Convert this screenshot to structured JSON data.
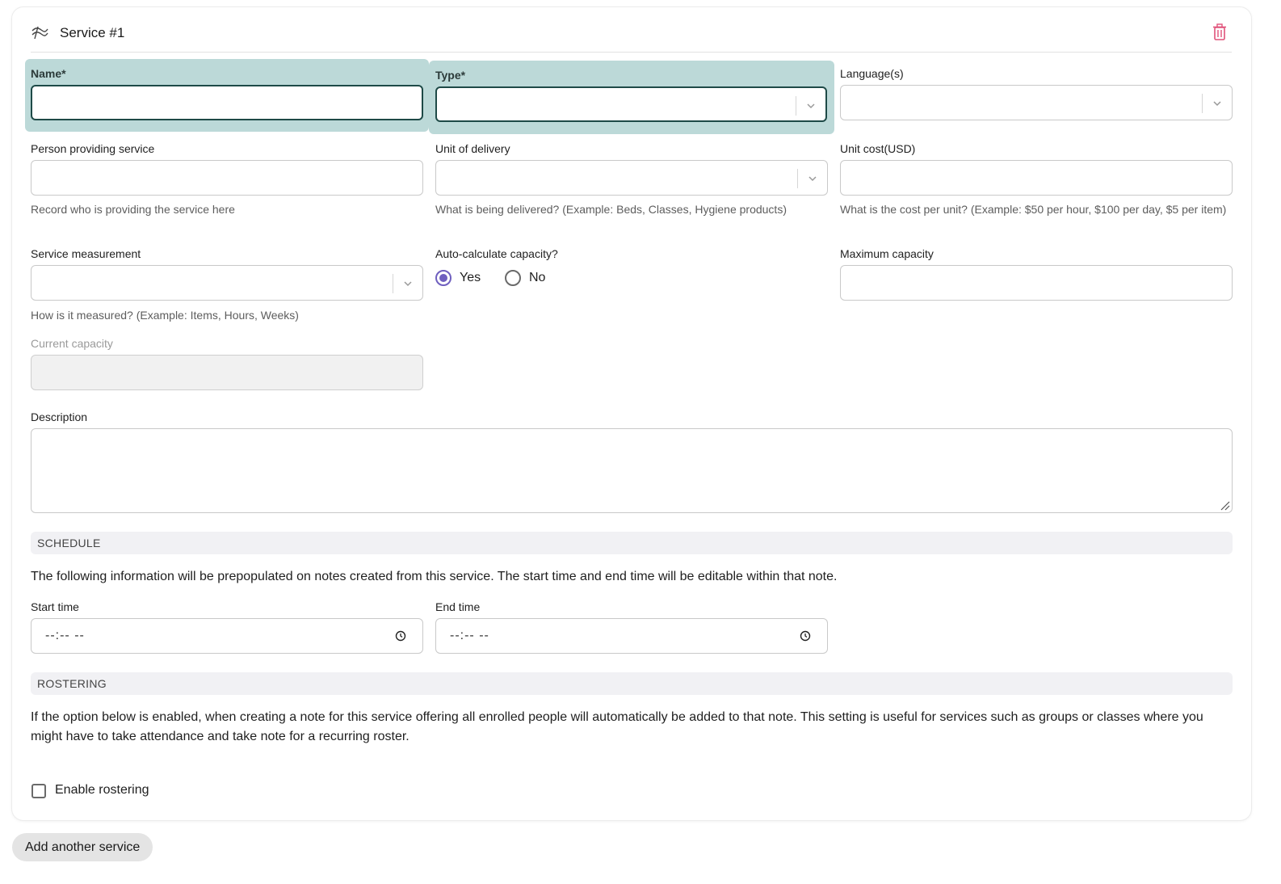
{
  "service": {
    "title": "Service #1",
    "fields": {
      "name": {
        "label": "Name",
        "required_mark": "*",
        "value": ""
      },
      "type": {
        "label": "Type",
        "required_mark": "*",
        "value": ""
      },
      "languages": {
        "label": "Language(s)",
        "value": ""
      },
      "person": {
        "label": "Person providing service",
        "value": "",
        "help": "Record who is providing the service here"
      },
      "unit_delivery": {
        "label": "Unit of delivery",
        "value": "",
        "help": "What is being delivered? (Example: Beds, Classes, Hygiene products)"
      },
      "unit_cost": {
        "label": "Unit cost(USD)",
        "value": "",
        "help": "What is the cost per unit? (Example: $50 per hour, $100 per day, $5 per item)"
      },
      "measurement": {
        "label": "Service measurement",
        "value": "",
        "help": "How is it measured? (Example: Items, Hours, Weeks)"
      },
      "auto_calc": {
        "label": "Auto-calculate capacity?",
        "options": [
          "Yes",
          "No"
        ],
        "selected": "Yes"
      },
      "max_capacity": {
        "label": "Maximum capacity",
        "value": ""
      },
      "current_capacity": {
        "label": "Current capacity",
        "value": ""
      },
      "description": {
        "label": "Description",
        "value": ""
      }
    },
    "schedule": {
      "heading": "SCHEDULE",
      "text": "The following information will be prepopulated on notes created from this service. The start time and end time will be editable within that note.",
      "start_label": "Start time",
      "end_label": "End time",
      "start_value": "--:-- --",
      "end_value": "--:-- --"
    },
    "rostering": {
      "heading": "ROSTERING",
      "text": "If the option below is enabled, when creating a note for this service offering all enrolled people will automatically be added to that note. This setting is useful for services such as groups or classes where you might have to take attendance and take note for a recurring roster.",
      "checkbox_label": "Enable rostering",
      "enabled": false
    }
  },
  "add_button_label": "Add another service",
  "colors": {
    "required_highlight": "#bcd9d8",
    "focus_border": "#1e4a47",
    "radio_accent": "#6f5fbf",
    "delete_icon": "#e0527a"
  },
  "icons": {
    "drag": "drag-handle-icon",
    "delete": "trash-icon",
    "dropdown": "chevron-down-icon",
    "clock": "clock-icon",
    "resize": "resize-grip-icon"
  }
}
